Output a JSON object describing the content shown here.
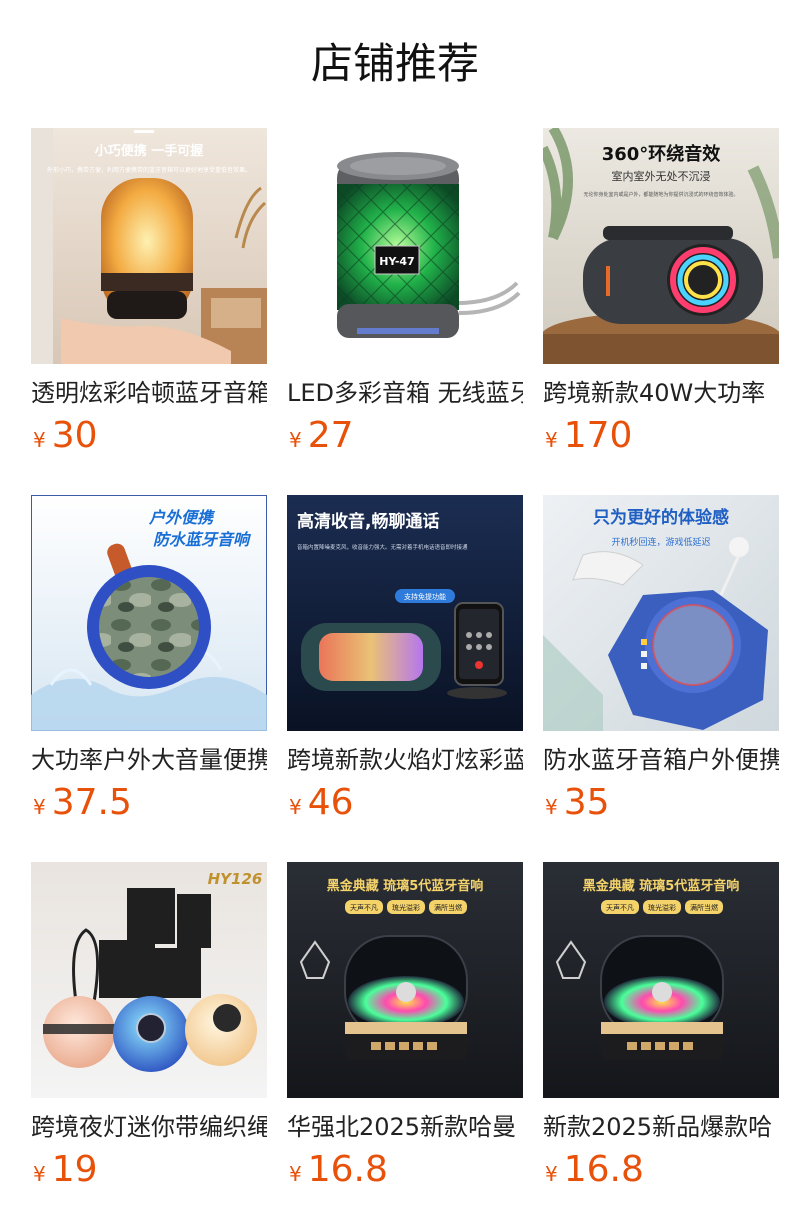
{
  "header": {
    "title": "店铺推荐"
  },
  "currency": "¥",
  "products": [
    {
      "name": "透明炫彩哈顿蓝牙音箱",
      "price": "30",
      "image_texts": [
        "小巧便携 一手可握",
        "外形小巧，携带方便，利用方便携带的蓝牙音箱可以更好地享受重低音效果。"
      ],
      "icon": "transparent-lantern-speaker-icon"
    },
    {
      "name": "LED多彩音箱 无线蓝牙",
      "price": "27",
      "image_texts": [
        "HY-47"
      ],
      "icon": "green-led-speaker-icon"
    },
    {
      "name": "跨境新款40W大功率",
      "price": "170",
      "image_texts": [
        "360°环绕音效",
        "室内室外无处不沉浸",
        "无论你身处室内或是户外，都能随地为你提供沉浸式的环绕音效体验。"
      ],
      "icon": "boombox-speaker-icon"
    },
    {
      "name": "大功率户外大音量便携",
      "price": "37.5",
      "image_texts": [
        "户外便携",
        "防水蓝牙音响"
      ],
      "icon": "camo-waterproof-speaker-icon"
    },
    {
      "name": "跨境新款火焰灯炫彩蓝",
      "price": "46",
      "image_texts": [
        "高清收音,畅聊通话",
        "音箱内置降噪麦克风，收音能力强大。无需对着手机电话语音即时接通",
        "支持免提功能"
      ],
      "icon": "flame-light-speaker-icon"
    },
    {
      "name": "防水蓝牙音箱户外便携",
      "price": "35",
      "image_texts": [
        "只为更好的体验感",
        "开机秒回连，游戏低延迟"
      ],
      "icon": "blue-outdoor-speaker-icon"
    },
    {
      "name": "跨境夜灯迷你带编织绳",
      "price": "19",
      "image_texts": [
        "HY126"
      ],
      "icon": "night-light-mini-speaker-icon"
    },
    {
      "name": "华强北2025新款哈曼",
      "price": "16.8",
      "image_texts": [
        "黑金典藏 琉璃5代蓝牙音响",
        "天声不凡",
        "琉光溢彩",
        "满所当燃"
      ],
      "icon": "glass-rgb-speaker-icon"
    },
    {
      "name": "新款2025新品爆款哈",
      "price": "16.8",
      "image_texts": [
        "黑金典藏 琉璃5代蓝牙音响",
        "天声不凡",
        "琉光溢彩",
        "满所当燃"
      ],
      "icon": "glass-rgb-speaker-icon"
    }
  ],
  "colors": {
    "price": "#e8510a",
    "title": "#111111"
  }
}
